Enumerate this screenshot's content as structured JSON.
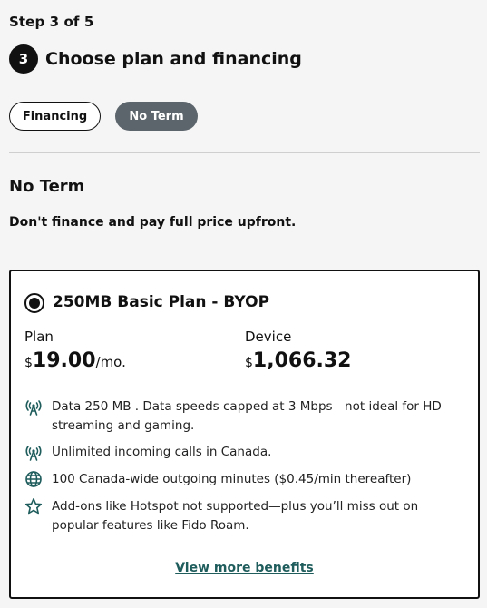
{
  "step_label": "Step 3 of 5",
  "step_number": "3",
  "page_title": "Choose plan and financing",
  "toggles": [
    {
      "label": "Financing",
      "selected": false
    },
    {
      "label": "No Term",
      "selected": true
    }
  ],
  "section": {
    "title": "No Term",
    "description": "Don't finance and pay full price upfront."
  },
  "plan": {
    "name": "250MB Basic Plan - BYOP",
    "selected": true,
    "plan_label": "Plan",
    "plan_currency": "$",
    "plan_price": "19.00",
    "plan_suffix": "/mo.",
    "device_label": "Device",
    "device_currency": "$",
    "device_price": "1,066.32",
    "features": [
      {
        "icon": "signal-tower-icon",
        "text": "Data 250 MB . Data speeds capped at 3 Mbps—not ideal for HD streaming and gaming."
      },
      {
        "icon": "signal-tower-icon",
        "text": "Unlimited incoming calls in Canada."
      },
      {
        "icon": "globe-icon",
        "text": "100 Canada-wide outgoing minutes ($0.45/min thereafter)"
      },
      {
        "icon": "star-icon",
        "text": "Add-ons like Hotspot not supported—plus you’ll miss out on popular features like Fido Roam."
      }
    ],
    "view_more": "View more benefits"
  },
  "colors": {
    "accent_teal": "#1f5c5c",
    "active_toggle": "#5c656b"
  }
}
